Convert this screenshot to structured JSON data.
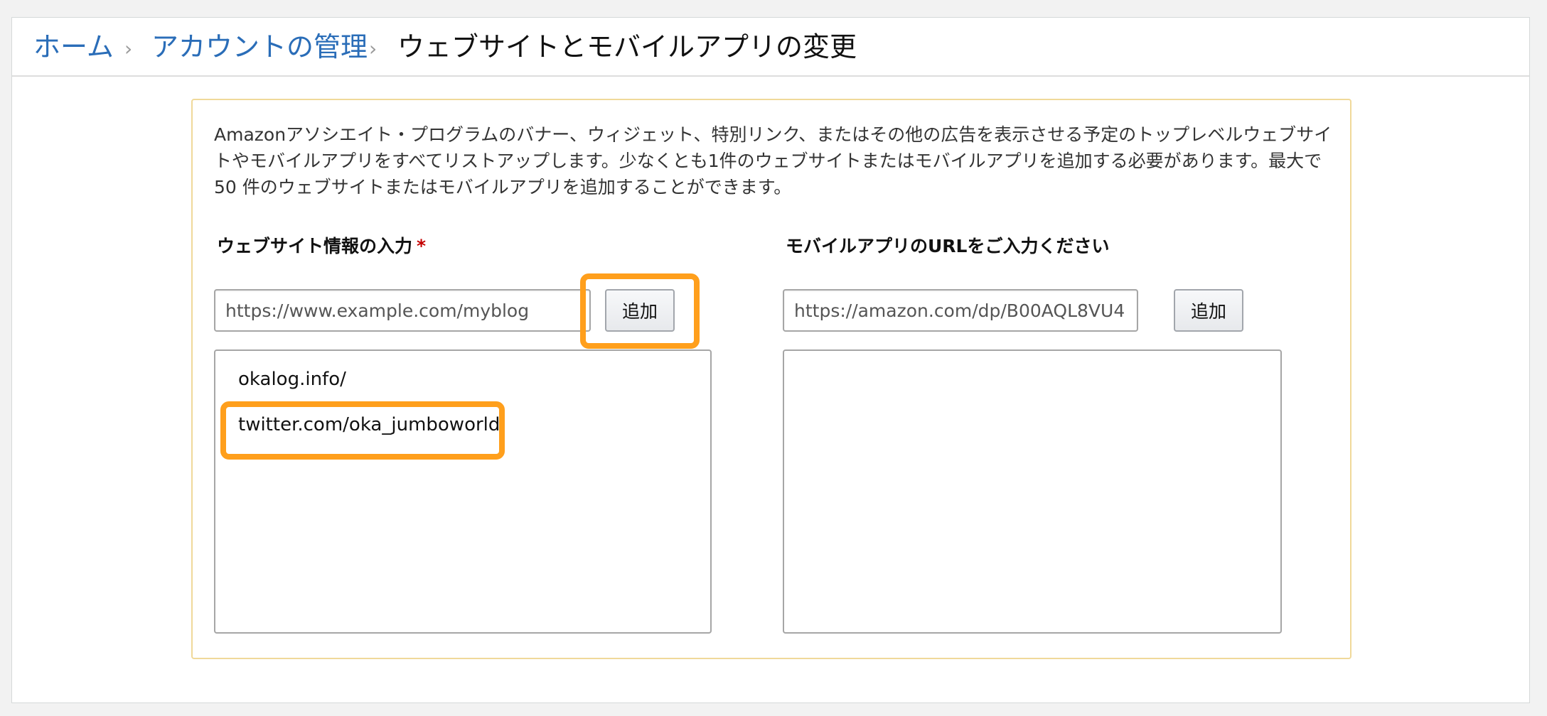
{
  "breadcrumb": {
    "home": "ホーム",
    "account": "アカウントの管理",
    "current": "ウェブサイトとモバイルアプリの変更",
    "separator": "›"
  },
  "description": "Amazonアソシエイト・プログラムのバナー、ウィジェット、特別リンク、またはその他の広告を表示させる予定のトップレベルウェブサイトやモバイルアプリをすべてリストアップします。少なくとも1件のウェブサイトまたはモバイルアプリを追加する必要があります。最大で 50 件のウェブサイトまたはモバイルアプリを追加することができます。",
  "website": {
    "label": "ウェブサイト情報の入力",
    "required_mark": "*",
    "placeholder": "https://www.example.com/myblog",
    "add_label": "追加",
    "items": [
      "okalog.info/",
      "twitter.com/oka_jumboworld"
    ]
  },
  "mobile": {
    "label": "モバイルアプリのURLをご入力ください",
    "placeholder": "https://amazon.com/dp/B00AQL8VU4",
    "add_label": "追加",
    "items": []
  },
  "colors": {
    "link": "#2a6db8",
    "highlight": "#ff9f1c",
    "panel_border": "#f0d99a",
    "required": "#c40000"
  }
}
